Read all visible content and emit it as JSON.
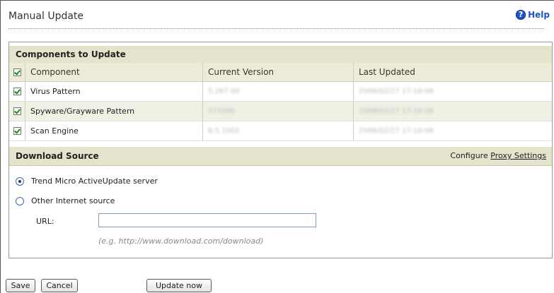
{
  "page": {
    "title": "Manual Update",
    "help_label": "Help"
  },
  "components": {
    "section_title": "Components to Update",
    "columns": [
      "Component",
      "Current Version",
      "Last Updated"
    ],
    "rows": [
      {
        "name": "Virus Pattern",
        "version": "5.267.00",
        "updated": "2008/02/27 17:16:08",
        "checked": true
      },
      {
        "name": "Spyware/Grayware Pattern",
        "version": "371000",
        "updated": "2008/02/27 17:16:08",
        "checked": true
      },
      {
        "name": "Scan Engine",
        "version": "8.5.1002",
        "updated": "2008/02/27 17:16:08",
        "checked": true
      }
    ],
    "all_checked": true
  },
  "download": {
    "section_title": "Download Source",
    "configure_prefix": "Configure",
    "proxy_link": "Proxy Settings",
    "option_activeupdate": "Trend Micro ActiveUpdate server",
    "option_other": "Other Internet source",
    "selected": "activeupdate",
    "url_label": "URL:",
    "url_value": "",
    "url_hint": "(e.g. http://www.download.com/download)"
  },
  "buttons": {
    "save": "Save",
    "cancel": "Cancel",
    "update_now": "Update now"
  }
}
